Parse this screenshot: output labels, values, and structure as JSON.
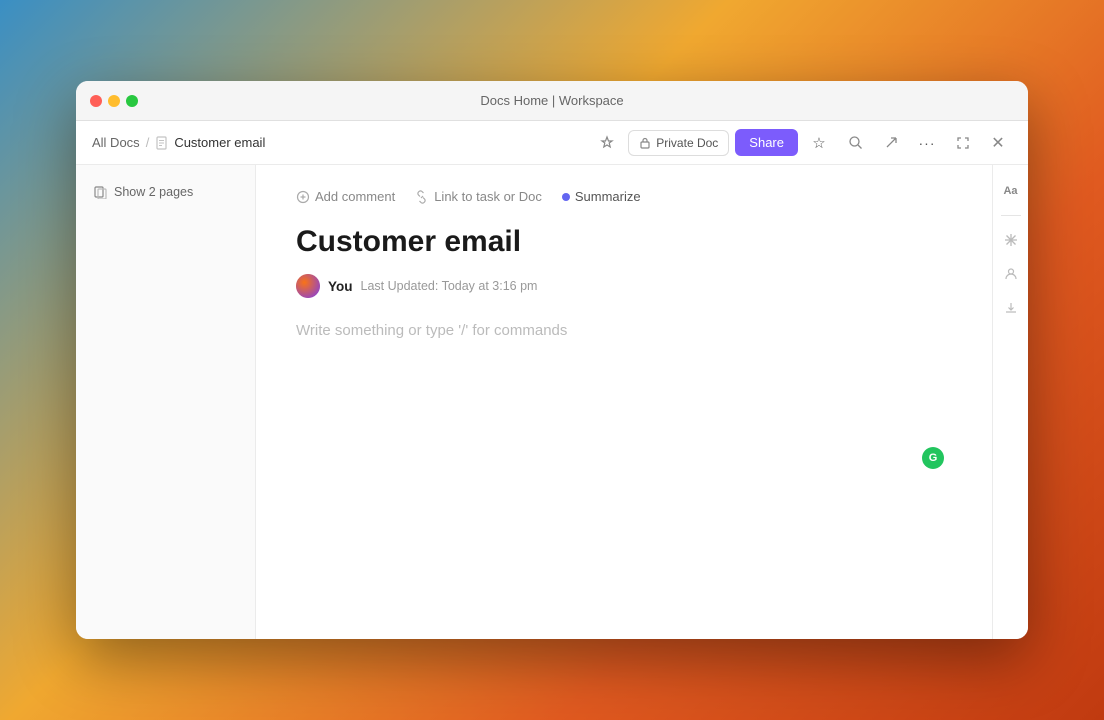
{
  "window": {
    "title": "Docs Home | Workspace"
  },
  "titleBar": {
    "title": "Docs Home | Workspace"
  },
  "toolbar": {
    "breadcrumb": {
      "parent": "All Docs",
      "separator": "/",
      "current": "Customer email"
    },
    "privateDoc": "Private Doc",
    "share": "Share"
  },
  "sidebar": {
    "showPages": "Show 2 pages"
  },
  "editorToolbar": {
    "addComment": "Add comment",
    "linkToTask": "Link to task or Doc",
    "summarize": "Summarize"
  },
  "document": {
    "title": "Customer email",
    "author": "You",
    "lastUpdated": "Last Updated: Today at 3:16 pm",
    "placeholder": "Write something or type '/' for commands"
  },
  "icons": {
    "close": "✕",
    "minimize": "−",
    "expand": "⤢",
    "more": "···",
    "star": "☆",
    "search": "⌕",
    "export": "↗",
    "lock": "🔒",
    "pages": "⊞",
    "comment": "💬",
    "link": "🔗",
    "aa": "Aa",
    "snowflake": "❄",
    "person": "👤",
    "download": "↓"
  }
}
